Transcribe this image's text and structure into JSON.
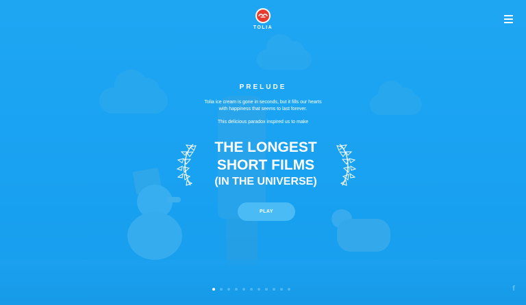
{
  "brand": {
    "name": "TOLIA",
    "logo_icon": "tolia-bird-logo-icon",
    "logo_color": "#e63b2e"
  },
  "nav": {
    "menu_icon": "hamburger-menu-icon"
  },
  "intro": {
    "heading": "PRELUDE",
    "description_line1": "Tolia ice cream is gone in seconds, but it fills our hearts",
    "description_line2": "with happiness that seems to last forever.",
    "inspiration": "This delicious paradox inspired us to make"
  },
  "headline": {
    "line1": "THE LONGEST",
    "line2": "SHORT FILMS",
    "line3": "(IN THE UNIVERSE)"
  },
  "play_button": {
    "label": "PLAY"
  },
  "pager": {
    "count": 11,
    "active_index": 0
  },
  "social": {
    "facebook_label": "f",
    "facebook_icon": "facebook-icon"
  },
  "colors": {
    "background": "#1aa3f2",
    "button": "#4bbbf6",
    "text": "#ffffff"
  }
}
